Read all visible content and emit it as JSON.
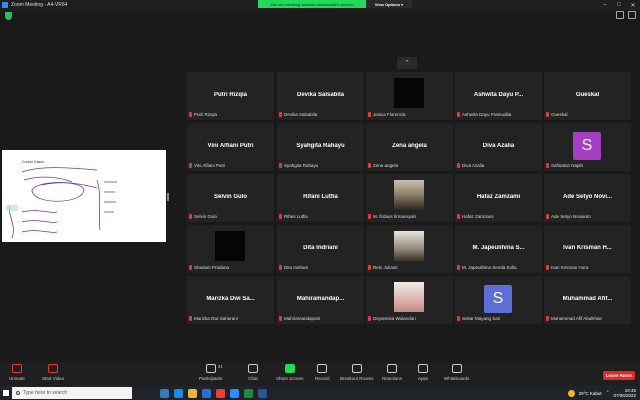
{
  "titlebar": {
    "title": "Zoom Meeting - A4-VR64"
  },
  "share_banner": {
    "message": "You are viewing ananda rahmawati's screen",
    "options": "View Options ▾"
  },
  "shared_screen": {
    "doc_title": "Contoh Kasus"
  },
  "participants": [
    {
      "big": "Putri Rizqia",
      "small": "Putri Rizqia",
      "type": "name"
    },
    {
      "big": "Devika Salsabila",
      "small": "Devika Salsabila",
      "type": "name"
    },
    {
      "big": "",
      "small": "Jesica Florencia",
      "type": "video",
      "style": "dark"
    },
    {
      "big": "Ashwita Dayu P...",
      "small": "Ashwita Dayu Pramudita",
      "type": "name"
    },
    {
      "big": "Gueskal",
      "small": "Gueskal",
      "type": "name"
    },
    {
      "big": "Vini Alfiani Putri",
      "small": "Vini Alfiani Putri",
      "type": "name"
    },
    {
      "big": "Syahgita Rahayu",
      "small": "Syahgita Rahayu",
      "type": "name"
    },
    {
      "big": "Zena angela",
      "small": "Zena angela",
      "type": "name"
    },
    {
      "big": "Diva Azalia",
      "small": "Diva Azalia",
      "type": "name"
    },
    {
      "big": "",
      "small": "Safinatun Najah",
      "type": "avatar",
      "letter": "S",
      "color": "#a63fc4"
    },
    {
      "big": "Selvin Gulo",
      "small": "Selvin Gulo",
      "type": "name"
    },
    {
      "big": "Rifani Lutfia",
      "small": "Rifani Lutfia",
      "type": "name"
    },
    {
      "big": "",
      "small": "M. firdaus firmansyah",
      "type": "video",
      "style": "landscape"
    },
    {
      "big": "Hafaz Zamzami",
      "small": "Hafaz Zamzami",
      "type": "name"
    },
    {
      "big": "Ade Setyo Novi...",
      "small": "Ade Setyo Novianto",
      "type": "name"
    },
    {
      "big": "",
      "small": "Shadam Pradana",
      "type": "video",
      "style": "dark"
    },
    {
      "big": "Dita Indriani",
      "small": "Dita Indriani",
      "type": "name"
    },
    {
      "big": "",
      "small": "Reni Julianti",
      "type": "video",
      "style": "portrait1"
    },
    {
      "big": "M. Japeulihina S...",
      "small": "M. Japeulihina Senda Solla",
      "type": "name"
    },
    {
      "big": "Ivan Krisman H...",
      "small": "Ivan Krisman Hura",
      "type": "name"
    },
    {
      "big": "Marizka Dwi Sa...",
      "small": "Marizka Dwi Saharani",
      "type": "name"
    },
    {
      "big": "Mahiramandap...",
      "small": "Mahiramandaputri",
      "type": "name"
    },
    {
      "big": "",
      "small": "Deyannisa Wulandari",
      "type": "video",
      "style": "portrait2"
    },
    {
      "big": "",
      "small": "Sekar Mayang Sari",
      "type": "avatar",
      "letter": "S",
      "color": "#5b6fd6"
    },
    {
      "big": "Muhammad Afif...",
      "small": "Muhammad Afif Abulkhair",
      "type": "name"
    }
  ],
  "toolbar": {
    "unmute": "Unmute",
    "start_video": "Start Video",
    "participants": "Participants",
    "participants_count": "41",
    "chat": "Chat",
    "share_screen": "Share Screen",
    "record": "Record",
    "breakout_rooms": "Breakout Rooms",
    "reactions": "Reactions",
    "apps": "Apps",
    "whiteboards": "Whiteboards",
    "leave": "Leave Room"
  },
  "taskbar": {
    "search_placeholder": "Type here to search",
    "weather": "29°C  Kabut",
    "time": "10:45",
    "date": "07/06/2022"
  }
}
